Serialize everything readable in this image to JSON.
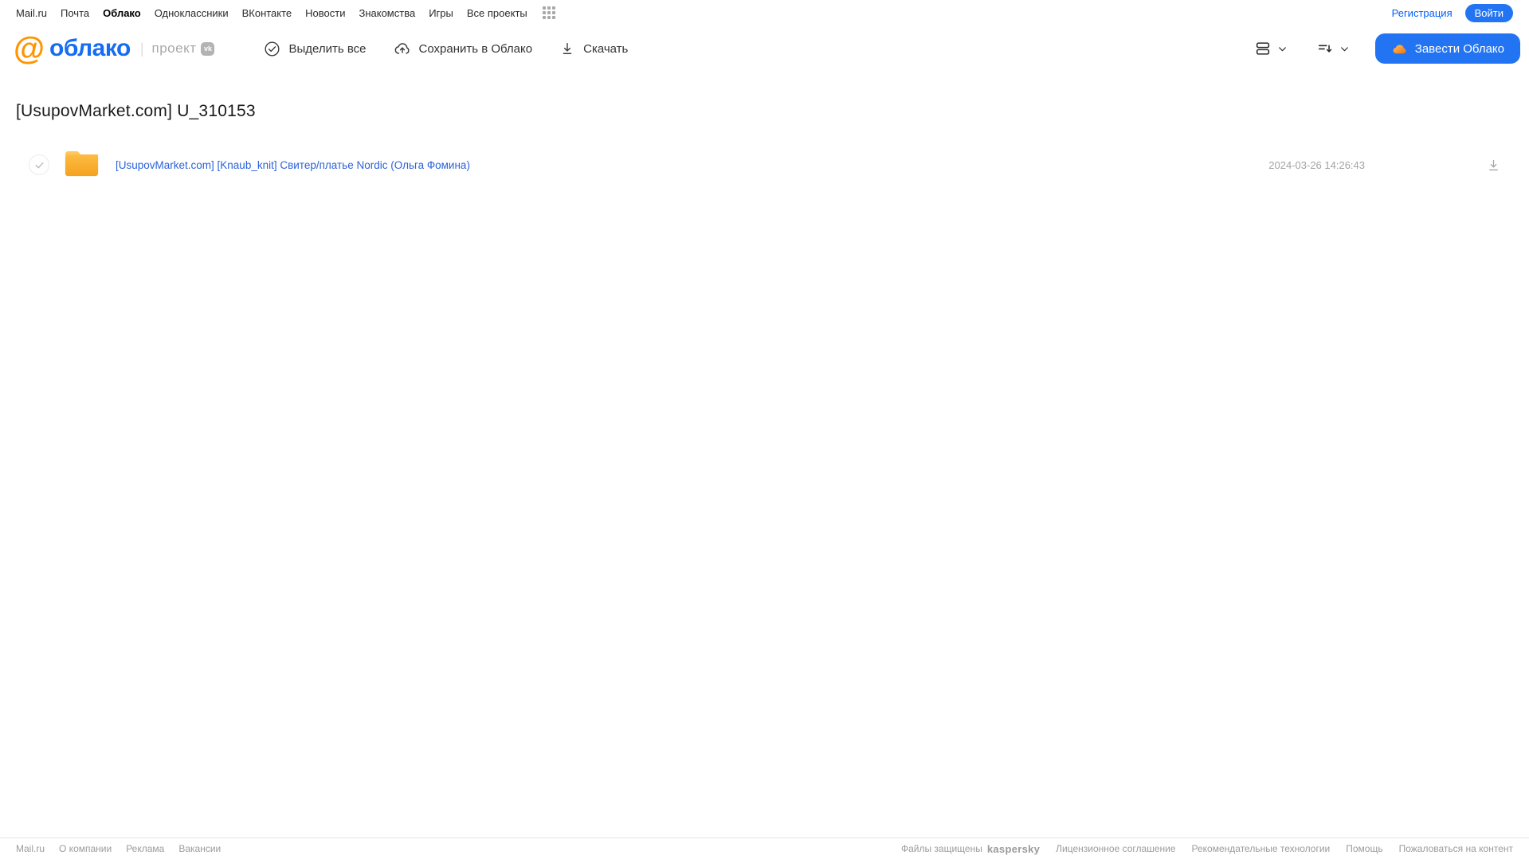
{
  "topnav": {
    "links": [
      "Mail.ru",
      "Почта",
      "Облако",
      "Одноклассники",
      "ВКонтакте",
      "Новости",
      "Знакомства",
      "Игры",
      "Все проекты"
    ],
    "registration": "Регистрация",
    "login": "Войти"
  },
  "header": {
    "logo_at": "@",
    "logo_word": "облако",
    "divider": "|",
    "project_label": "проект",
    "vk_badge": "vk",
    "toolbar": {
      "select_all": "Выделить все",
      "save_to_cloud": "Сохранить в Облако",
      "download": "Скачать"
    },
    "create_cloud_button": "Завести Облако"
  },
  "main": {
    "title": "[UsupovMarket.com] U_310153",
    "files": [
      {
        "name": "[UsupovMarket.com] [Knaub_knit] Свитер/платье Nordic (Ольга Фомина)",
        "date": "2024-03-26 14:26:43",
        "type": "folder"
      }
    ]
  },
  "footer": {
    "left_links": [
      "Mail.ru",
      "О компании",
      "Реклама",
      "Вакансии"
    ],
    "protected_label": "Файлы защищены",
    "kaspersky_logo": "kaspersky",
    "right_links": [
      "Лицензионное соглашение",
      "Рекомендательные технологии",
      "Помощь",
      "Пожаловаться на контент"
    ]
  },
  "colors": {
    "accent_blue": "#2374f2",
    "link_blue": "#005ff9",
    "file_link_blue": "#2b62d9",
    "logo_orange": "#ff9500",
    "logo_blue": "#156df2",
    "folder_orange": "#f8ad2b",
    "kaspersky_teal": "#00a88e"
  }
}
